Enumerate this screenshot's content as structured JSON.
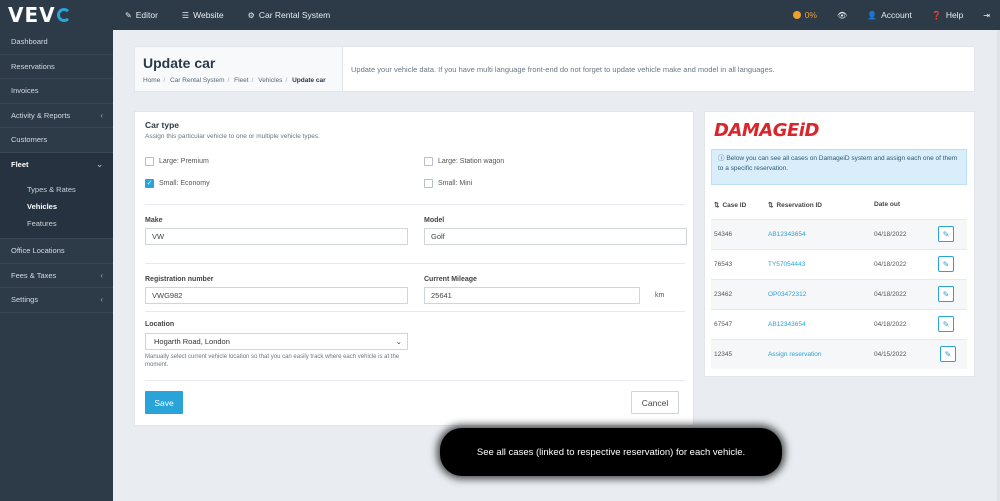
{
  "brand": {
    "logo_text": "VEV",
    "accent": "#2aa3d8"
  },
  "topnav": {
    "items": [
      {
        "label": "Editor",
        "icon": "pencil-icon"
      },
      {
        "label": "Website",
        "icon": "list-icon"
      },
      {
        "label": "Car Rental System",
        "icon": "gear-icon"
      }
    ],
    "right": {
      "progress": "0%",
      "account": "Account",
      "help": "Help"
    }
  },
  "sidebar": {
    "items": [
      {
        "label": "Dashboard"
      },
      {
        "label": "Reservations"
      },
      {
        "label": "Invoices"
      },
      {
        "label": "Activity & Reports"
      },
      {
        "label": "Customers"
      },
      {
        "label": "Fleet"
      },
      {
        "label": "Office Locations"
      },
      {
        "label": "Fees & Taxes"
      },
      {
        "label": "Settings"
      }
    ],
    "fleet_sub": [
      "Types & Rates",
      "Vehicles",
      "Features"
    ]
  },
  "header": {
    "title": "Update car",
    "breadcrumb": [
      "Home",
      "Car Rental System",
      "Fleet",
      "Vehicles",
      "Update car"
    ],
    "description": "Update your vehicle data. If you have multi language front-end do not forget to update vehicle make and model in all languages."
  },
  "form": {
    "car_type_title": "Car type",
    "car_type_sub": "Assign this particular vehicle to one or multiple vehicle types.",
    "types": [
      {
        "label": "Large: Premium",
        "checked": false
      },
      {
        "label": "Large: Station wagon",
        "checked": false
      },
      {
        "label": "Small: Economy",
        "checked": true
      },
      {
        "label": "Small: Mini",
        "checked": false
      }
    ],
    "make_label": "Make",
    "make_value": "VW",
    "model_label": "Model",
    "model_value": "Golf",
    "reg_label": "Registration number",
    "reg_value": "VWG982",
    "mileage_label": "Current Mileage",
    "mileage_value": "25641",
    "mileage_unit": "km",
    "location_label": "Location",
    "location_value": "Hogarth Road, London",
    "location_help": "Manually select current vehicle location so that you can easily track where each vehicle is at the moment.",
    "save_label": "Save",
    "cancel_label": "Cancel"
  },
  "damage": {
    "logo": "DAMAGE",
    "logo_id": "iD",
    "info": "Below you can see all cases on DamageiD system and assign each one of them to a specific reservation.",
    "columns": [
      "Case ID",
      "Reservation ID",
      "Date out"
    ],
    "rows": [
      {
        "case_id": "54346",
        "reservation": "AB12343654",
        "date_out": "04/18/2022"
      },
      {
        "case_id": "76543",
        "reservation": "TY57054443",
        "date_out": "04/18/2022"
      },
      {
        "case_id": "23462",
        "reservation": "OP03472312",
        "date_out": "04/18/2022"
      },
      {
        "case_id": "67547",
        "reservation": "AB12343654",
        "date_out": "04/18/2022"
      },
      {
        "case_id": "12345",
        "reservation": "Assign reservation",
        "date_out": "04/15/2022"
      }
    ]
  },
  "tooltip": "See all cases (linked to respective reservation) for each vehicle."
}
